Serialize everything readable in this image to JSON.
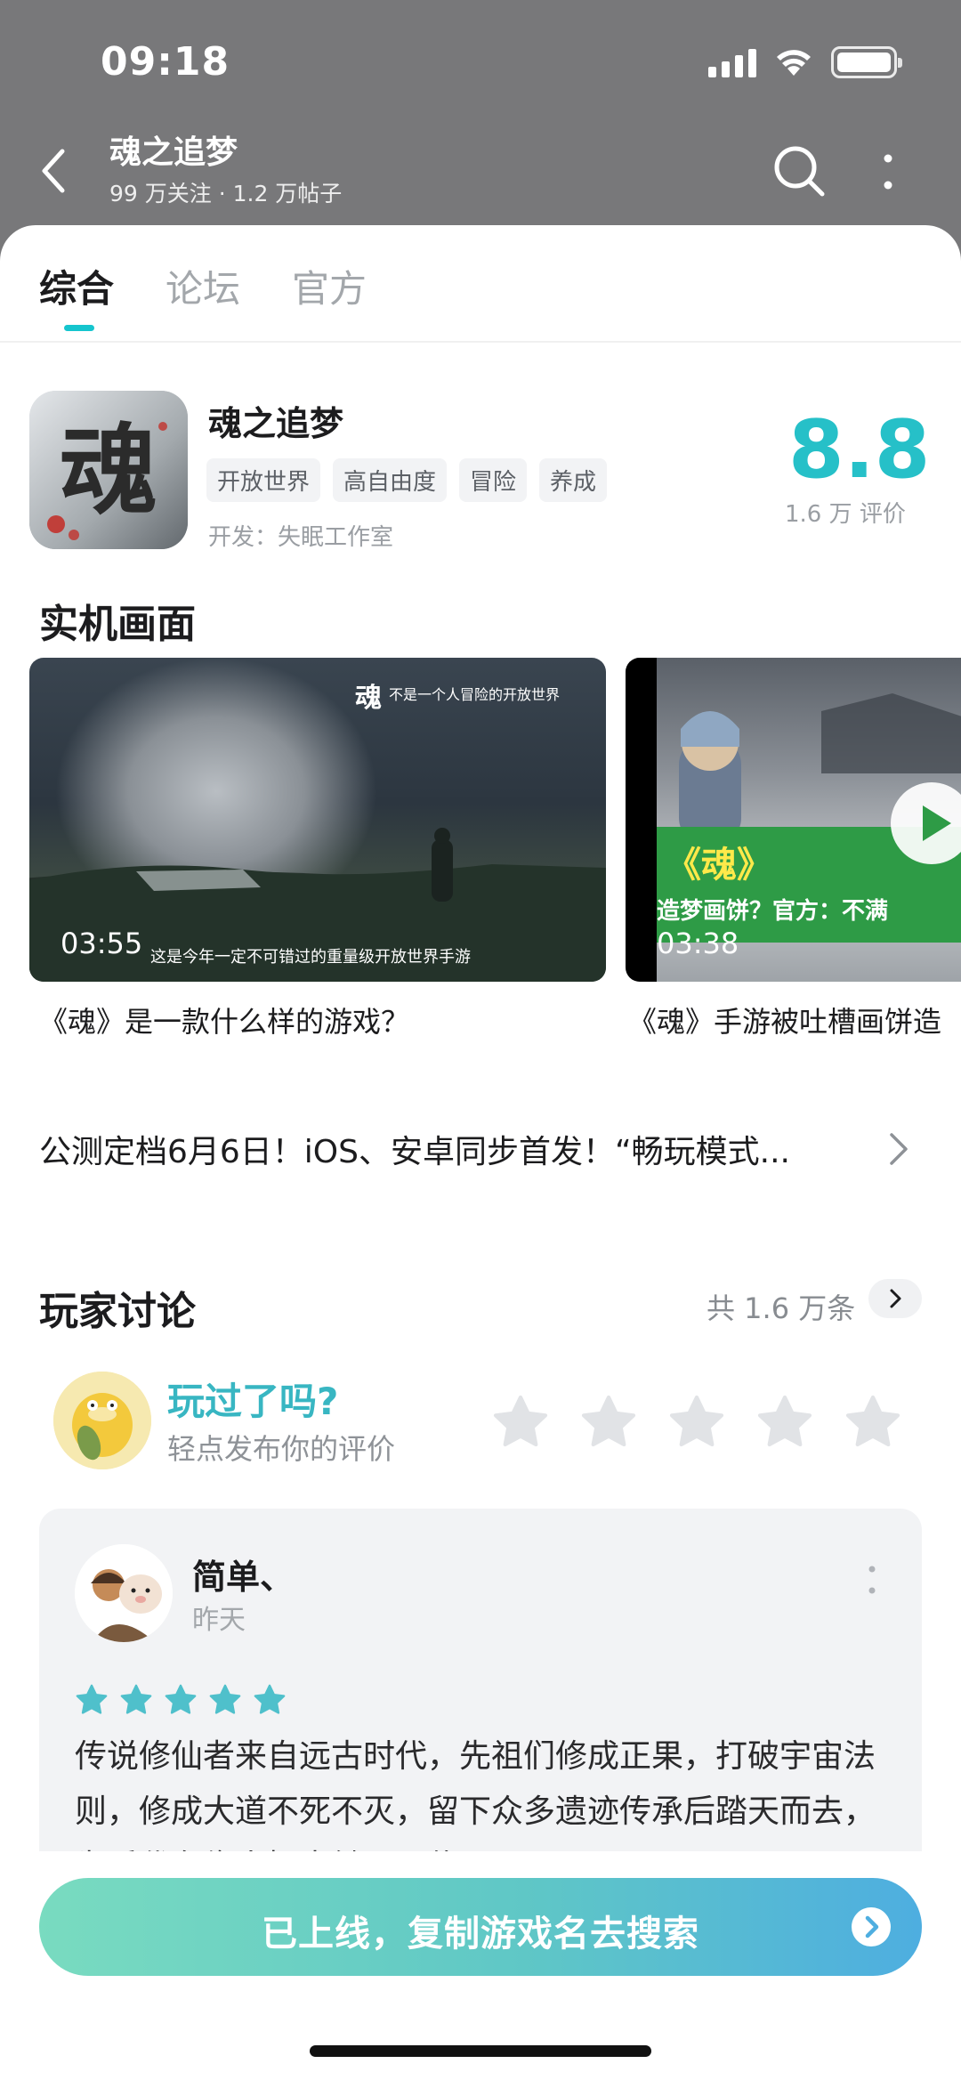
{
  "status_bar": {
    "time": "09:18"
  },
  "nav": {
    "title": "魂之追梦",
    "subtitle": "99 万关注 · 1.2 万帖子"
  },
  "tabs": [
    {
      "label": "综合",
      "active": true
    },
    {
      "label": "论坛",
      "active": false
    },
    {
      "label": "官方",
      "active": false
    }
  ],
  "game": {
    "name": "魂之追梦",
    "tags": [
      "开放世界",
      "高自由度",
      "冒险",
      "养成"
    ],
    "developer": "开发：失眠工作室",
    "score": "8.8",
    "rating_count": "1.6 万 评价",
    "icon_glyph": "魂",
    "accent_color": "#26c0c8"
  },
  "screenshots": {
    "section_title": "实机画面",
    "videos": [
      {
        "duration": "03:55",
        "caption": "这是今年一定不可错过的重量级开放世界手游",
        "overlay_logo": "魂",
        "overlay_text": "不是一个人冒险的开放世界",
        "title": "《魂》是一款什么样的游戏？"
      },
      {
        "duration": "03:38",
        "band_title": "《魂》",
        "band_text": "造梦画饼？官方：不满",
        "title": "《魂》手游被吐槽画饼造"
      }
    ]
  },
  "notice": {
    "text": "公测定档6月6日！iOS、安卓同步首发！“畅玩模式..."
  },
  "discussion": {
    "section_title": "玩家讨论",
    "total": "共 1.6 万条",
    "prompt_title": "玩过了吗?",
    "prompt_hint": "轻点发布你的评价",
    "rating_stars": 5,
    "review": {
      "author": "简单、",
      "time": "昨天",
      "stars": 5,
      "body": "传说修仙者来自远古时代，先祖们修成正果，打破宇宙法则，修成大道不死不灭，留下众多遗迹传承后踏天而去，为后代有缘人探索继承，传承不死不灭"
    }
  },
  "cta": {
    "label": "已上线，复制游戏名去搜索"
  },
  "colors": {
    "header_gray": "#78787a",
    "teal": "#26c0c8",
    "star_teal": "#4fc0cb",
    "star_empty": "#e1e3e6"
  }
}
